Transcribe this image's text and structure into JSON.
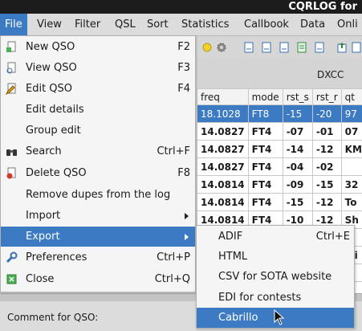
{
  "window": {
    "title": "CQRLOG for"
  },
  "menubar": [
    "File",
    "View",
    "Filter",
    "QSL",
    "Sort",
    "Statistics",
    "Callbook",
    "Data",
    "Onli"
  ],
  "grid": {
    "dxcc_label": "DXCC",
    "columns": [
      "freq",
      "mode",
      "rst_s",
      "rst_r",
      "qt"
    ],
    "rows": [
      [
        "18.1028",
        "FT8",
        "-15",
        "-20",
        "97"
      ],
      [
        "14.0827",
        "FT4",
        "-07",
        "-01",
        "07"
      ],
      [
        "14.0827",
        "FT4",
        "-14",
        "-12",
        "KM"
      ],
      [
        "14.0827",
        "FT4",
        "-04",
        "-02",
        ""
      ],
      [
        "14.0814",
        "FT4",
        "-09",
        "-15",
        "32"
      ],
      [
        "14.0814",
        "FT4",
        "-15",
        "-12",
        "To"
      ],
      [
        "14.0814",
        "FT4",
        "-10",
        "-12",
        "Sh"
      ],
      [
        "",
        "",
        "",
        "",
        ""
      ],
      [
        "",
        "",
        "",
        "",
        "Mi"
      ],
      [
        "",
        "",
        "",
        "",
        ""
      ]
    ]
  },
  "file_menu": {
    "items": [
      {
        "label": "New QSO",
        "shortcut": "F2",
        "icon": "new-qso-icon"
      },
      {
        "label": "View QSO",
        "shortcut": "F3",
        "icon": "view-qso-icon"
      },
      {
        "label": "Edit QSO",
        "shortcut": "F4",
        "icon": "edit-qso-icon"
      },
      {
        "label": "Edit details",
        "shortcut": "",
        "icon": ""
      },
      {
        "label": "Group edit",
        "shortcut": "",
        "icon": ""
      },
      {
        "label": "Search",
        "shortcut": "Ctrl+F",
        "icon": "binoculars-icon"
      },
      {
        "label": "Delete QSO",
        "shortcut": "F8",
        "icon": "delete-qso-icon"
      },
      {
        "label": "Remove dupes from the log",
        "shortcut": "",
        "icon": ""
      },
      {
        "label": "Import",
        "shortcut": "",
        "icon": ""
      },
      {
        "label": "Export",
        "shortcut": "",
        "icon": ""
      },
      {
        "label": "Preferences",
        "shortcut": "Ctrl+P",
        "icon": "wrench-icon"
      },
      {
        "label": "Close",
        "shortcut": "Ctrl+Q",
        "icon": "close-icon"
      }
    ]
  },
  "export_menu": {
    "items": [
      {
        "label": "ADIF",
        "shortcut": "Ctrl+E"
      },
      {
        "label": "HTML",
        "shortcut": ""
      },
      {
        "label": "CSV for SOTA website",
        "shortcut": ""
      },
      {
        "label": "EDI for contests",
        "shortcut": ""
      },
      {
        "label": "Cabrillo",
        "shortcut": ""
      }
    ]
  },
  "bottom": {
    "comment_label": "Comment for QSO:"
  },
  "colors": {
    "highlight": "#3c7bc3",
    "titlebar": "#1c1c1c",
    "menu_bg": "#f5f5f5"
  }
}
